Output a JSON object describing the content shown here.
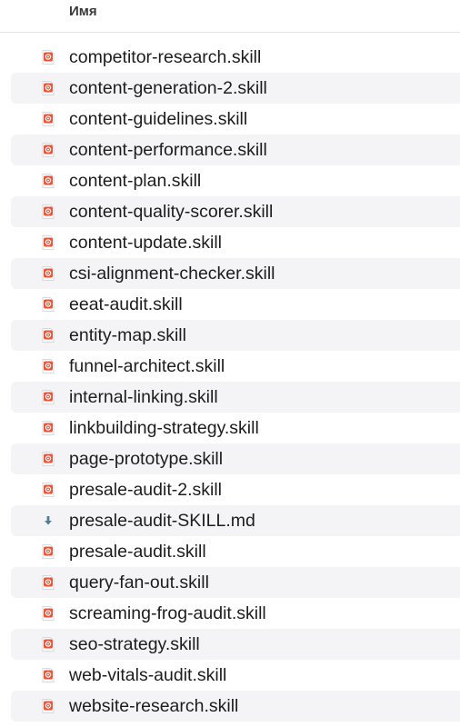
{
  "header": {
    "name_column": "Имя"
  },
  "files": [
    {
      "name": "competitor-research.skill",
      "icon": "skill-file-icon"
    },
    {
      "name": "content-generation-2.skill",
      "icon": "skill-file-icon"
    },
    {
      "name": "content-guidelines.skill",
      "icon": "skill-file-icon"
    },
    {
      "name": "content-performance.skill",
      "icon": "skill-file-icon"
    },
    {
      "name": "content-plan.skill",
      "icon": "skill-file-icon"
    },
    {
      "name": "content-quality-scorer.skill",
      "icon": "skill-file-icon"
    },
    {
      "name": "content-update.skill",
      "icon": "skill-file-icon"
    },
    {
      "name": "csi-alignment-checker.skill",
      "icon": "skill-file-icon"
    },
    {
      "name": "eeat-audit.skill",
      "icon": "skill-file-icon"
    },
    {
      "name": "entity-map.skill",
      "icon": "skill-file-icon"
    },
    {
      "name": "funnel-architect.skill",
      "icon": "skill-file-icon"
    },
    {
      "name": "internal-linking.skill",
      "icon": "skill-file-icon"
    },
    {
      "name": "linkbuilding-strategy.skill",
      "icon": "skill-file-icon"
    },
    {
      "name": "page-prototype.skill",
      "icon": "skill-file-icon"
    },
    {
      "name": "presale-audit-2.skill",
      "icon": "skill-file-icon"
    },
    {
      "name": "presale-audit-SKILL.md",
      "icon": "markdown-file-icon"
    },
    {
      "name": "presale-audit.skill",
      "icon": "skill-file-icon"
    },
    {
      "name": "query-fan-out.skill",
      "icon": "skill-file-icon"
    },
    {
      "name": "screaming-frog-audit.skill",
      "icon": "skill-file-icon"
    },
    {
      "name": "seo-strategy.skill",
      "icon": "skill-file-icon"
    },
    {
      "name": "web-vitals-audit.skill",
      "icon": "skill-file-icon"
    },
    {
      "name": "website-research.skill",
      "icon": "skill-file-icon"
    }
  ]
}
